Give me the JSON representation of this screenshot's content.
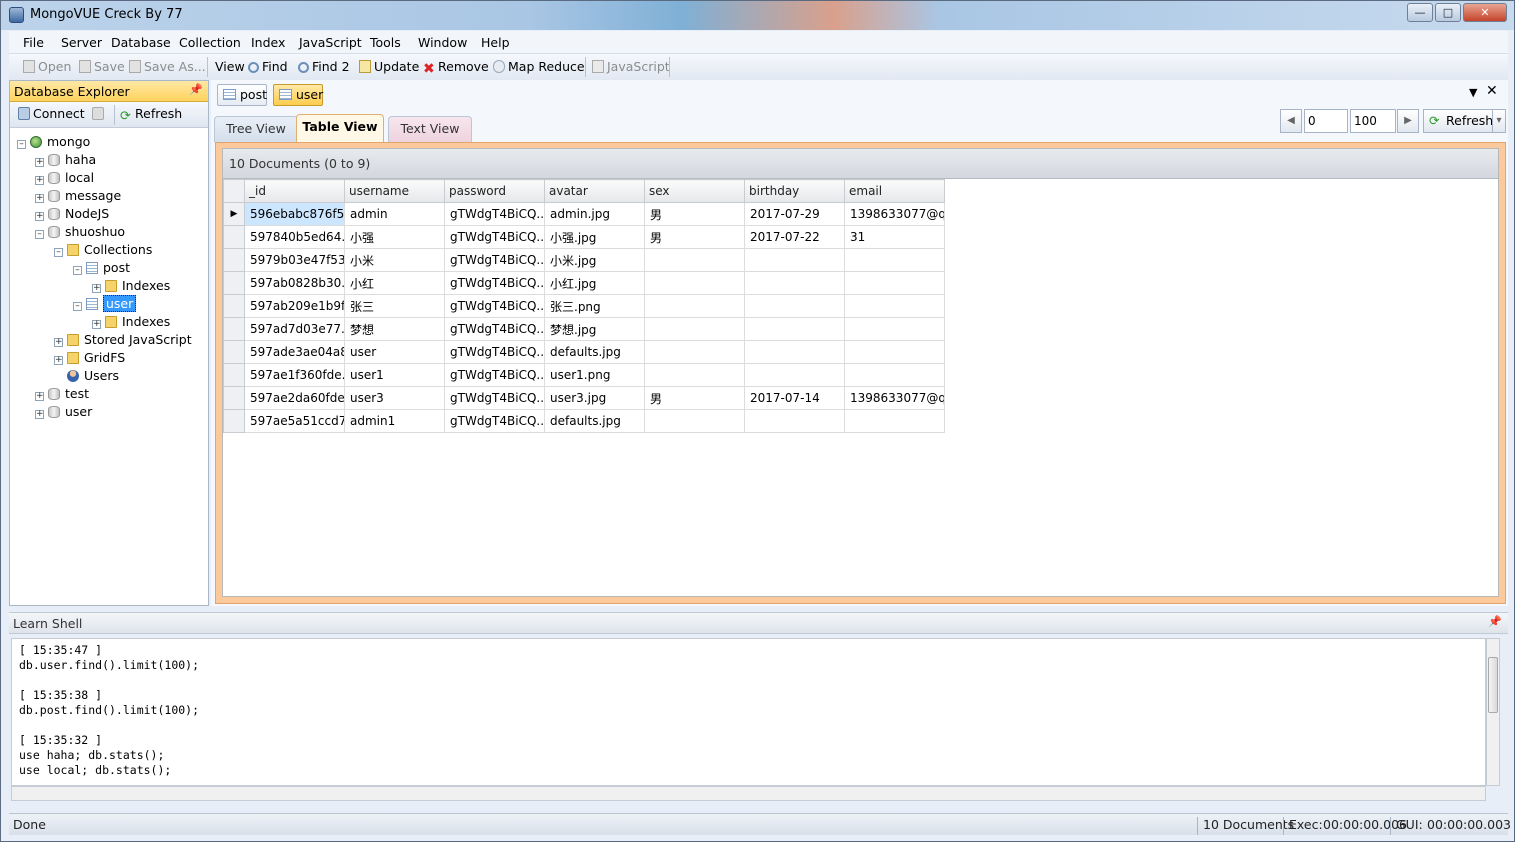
{
  "window": {
    "title": "MongoVUE Creck By 77"
  },
  "menu": [
    "File",
    "Server",
    "Database",
    "Collection",
    "Index",
    "JavaScript",
    "Tools",
    "Window",
    "Help"
  ],
  "toolbar": {
    "open": "Open",
    "save": "Save",
    "save_as": "Save As...",
    "view": "View",
    "find": "Find",
    "find2": "Find 2",
    "update": "Update",
    "remove": "Remove",
    "map_reduce": "Map Reduce",
    "javascript": "JavaScript"
  },
  "explorer": {
    "title": "Database Explorer",
    "connect": "Connect",
    "refresh": "Refresh",
    "tree": [
      "mongo",
      "haha",
      "local",
      "message",
      "NodeJS",
      "shuoshuo",
      "Collections",
      "post",
      "Indexes",
      "user",
      "Indexes",
      "Stored JavaScript",
      "GridFS",
      "Users",
      "test",
      "user"
    ]
  },
  "doc_tabs": [
    "post",
    "user"
  ],
  "view_tabs": [
    "Tree View",
    "Table View",
    "Text View"
  ],
  "pager": {
    "skip": "0",
    "limit": "100",
    "refresh": "Refresh"
  },
  "grid": {
    "summary": "10 Documents (0 to 9)",
    "columns": [
      "_id",
      "username",
      "password",
      "avatar",
      "sex",
      "birthday",
      "email"
    ],
    "rows": [
      [
        "596ebabc876f5...",
        "admin",
        "gTWdgT4BiCQ...",
        "admin.jpg",
        "男",
        "2017-07-29",
        "1398633077@q..."
      ],
      [
        "597840b5ed64...",
        "小强",
        "gTWdgT4BiCQ...",
        "小强.jpg",
        "男",
        "2017-07-22",
        "31"
      ],
      [
        "5979b03e47f53...",
        "小米",
        "gTWdgT4BiCQ...",
        "小米.jpg",
        "",
        "",
        ""
      ],
      [
        "597ab0828b30...",
        "小红",
        "gTWdgT4BiCQ...",
        "小红.jpg",
        "",
        "",
        ""
      ],
      [
        "597ab209e1b9f...",
        "张三",
        "gTWdgT4BiCQ...",
        "张三.png",
        "",
        "",
        ""
      ],
      [
        "597ad7d03e77...",
        "梦想",
        "gTWdgT4BiCQ...",
        "梦想.jpg",
        "",
        "",
        ""
      ],
      [
        "597ade3ae04a8...",
        "user",
        "gTWdgT4BiCQ...",
        "defaults.jpg",
        "",
        "",
        ""
      ],
      [
        "597ae1f360fde...",
        "user1",
        "gTWdgT4BiCQ...",
        "user1.png",
        "",
        "",
        ""
      ],
      [
        "597ae2da60fde...",
        "user3",
        "gTWdgT4BiCQ...",
        "user3.jpg",
        "男",
        "2017-07-14",
        "1398633077@q..."
      ],
      [
        "597ae5a51ccd7...",
        "admin1",
        "gTWdgT4BiCQ...",
        "defaults.jpg",
        "",
        "",
        ""
      ]
    ]
  },
  "shell": {
    "title": "Learn Shell",
    "lines": [
      "[ 15:35:47 ]",
      "db.user.find().limit(100);",
      "",
      "[ 15:35:38 ]",
      "db.post.find().limit(100);",
      "",
      "[ 15:35:32 ]",
      "use haha; db.stats();",
      "use local; db.stats();"
    ]
  },
  "status": {
    "text": "Done",
    "docs": "10 Documents",
    "exec_label": "Exec:",
    "exec": "00:00:00.006",
    "gui_label": "GUI:",
    "gui": "00:00:00.003"
  }
}
